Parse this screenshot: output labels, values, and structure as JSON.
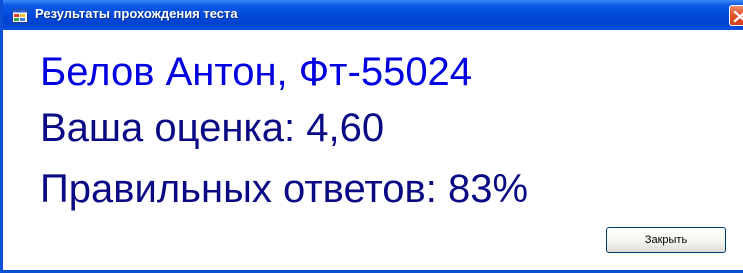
{
  "window": {
    "title": "Результаты прохождения теста",
    "icon": "app-icon",
    "close_icon": "close-icon"
  },
  "result": {
    "student": "Белов Антон, Фт-55024",
    "grade_line": "Ваша оценка: 4,60",
    "correct_line": "Правильных ответов: 83%"
  },
  "buttons": {
    "close_label": "Закрыть"
  },
  "colors": {
    "titlebar": "#0047d8",
    "name_text": "#0000e0",
    "result_text": "#0a0a84",
    "close_button": "#e2552f"
  }
}
